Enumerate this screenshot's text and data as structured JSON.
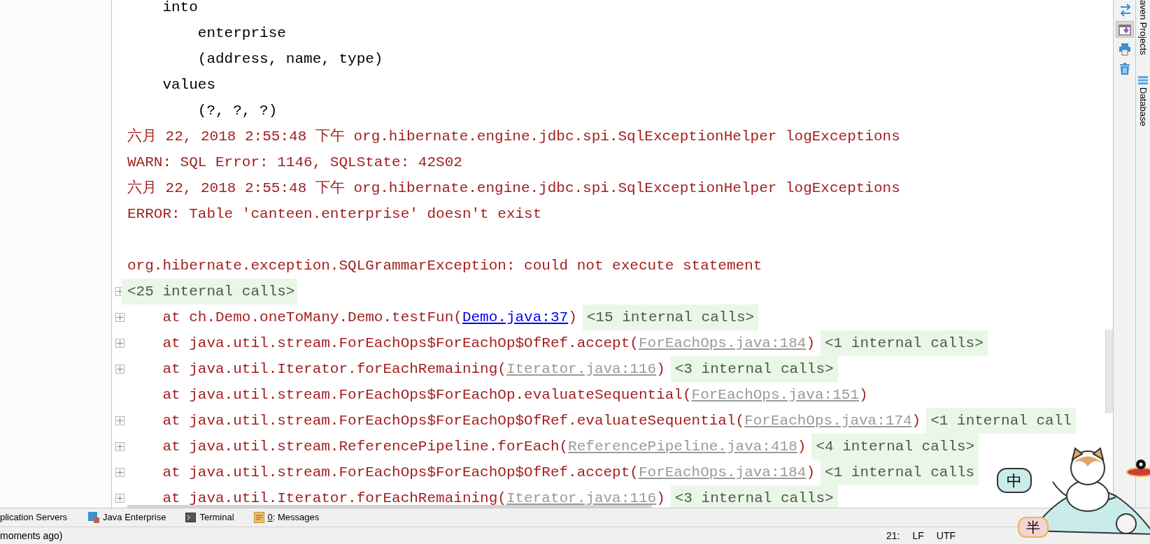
{
  "console": {
    "lines": [
      {
        "kind": "plain",
        "error": false,
        "text": "    into"
      },
      {
        "kind": "plain",
        "error": false,
        "text": "        enterprise"
      },
      {
        "kind": "plain",
        "error": false,
        "text": "        (address, name, type)"
      },
      {
        "kind": "plain",
        "error": false,
        "text": "    values"
      },
      {
        "kind": "plain",
        "error": false,
        "text": "        (?, ?, ?)"
      },
      {
        "kind": "plain",
        "error": true,
        "text": "六月 22, 2018 2:55:48 下午 org.hibernate.engine.jdbc.spi.SqlExceptionHelper logExceptions"
      },
      {
        "kind": "plain",
        "error": true,
        "text": "WARN: SQL Error: 1146, SQLState: 42S02"
      },
      {
        "kind": "plain",
        "error": true,
        "text": "六月 22, 2018 2:55:48 下午 org.hibernate.engine.jdbc.spi.SqlExceptionHelper logExceptions"
      },
      {
        "kind": "plain",
        "error": true,
        "text": "ERROR: Table 'canteen.enterprise' doesn't exist"
      },
      {
        "kind": "blank"
      },
      {
        "kind": "plain",
        "error": true,
        "text": "org.hibernate.exception.SQLGrammarException: could not execute statement"
      },
      {
        "kind": "internal",
        "foldable": true,
        "text": "<25 internal calls>"
      },
      {
        "kind": "frame",
        "foldable": true,
        "text": "    at ch.Demo.oneToMany.Demo.testFun(",
        "link": "Demo.java:37",
        "in_project": true,
        "tail": ")",
        "internal": "<15 internal calls>"
      },
      {
        "kind": "frame",
        "foldable": true,
        "text": "    at java.util.stream.ForEachOps$ForEachOp$OfRef.accept(",
        "link": "ForEachOps.java:184",
        "in_project": false,
        "tail": ")",
        "internal": "<1 internal calls>"
      },
      {
        "kind": "frame",
        "foldable": true,
        "text": "    at java.util.Iterator.forEachRemaining(",
        "link": "Iterator.java:116",
        "in_project": false,
        "tail": ")",
        "internal": "<3 internal calls>"
      },
      {
        "kind": "frame",
        "foldable": false,
        "text": "    at java.util.stream.ForEachOps$ForEachOp.evaluateSequential(",
        "link": "ForEachOps.java:151",
        "in_project": false,
        "tail": ")"
      },
      {
        "kind": "frame",
        "foldable": true,
        "text": "    at java.util.stream.ForEachOps$ForEachOp$OfRef.evaluateSequential(",
        "link": "ForEachOps.java:174",
        "in_project": false,
        "tail": ")",
        "internal": "<1 internal call"
      },
      {
        "kind": "frame",
        "foldable": true,
        "text": "    at java.util.stream.ReferencePipeline.forEach(",
        "link": "ReferencePipeline.java:418",
        "in_project": false,
        "tail": ")",
        "internal": "<4 internal calls>"
      },
      {
        "kind": "frame",
        "foldable": true,
        "text": "    at java.util.stream.ForEachOps$ForEachOp$OfRef.accept(",
        "link": "ForEachOps.java:184",
        "in_project": false,
        "tail": ")",
        "internal": "<1 internal calls"
      },
      {
        "kind": "frame",
        "foldable": true,
        "text": "    at java.util.Iterator.forEachRemaining(",
        "link": "Iterator.java:116",
        "in_project": false,
        "tail": ")",
        "internal": "<3 internal calls>"
      }
    ]
  },
  "right_toolbar": [
    {
      "kind": "swap",
      "selected": false
    },
    {
      "kind": "scroll-to-end",
      "selected": true
    },
    {
      "kind": "print",
      "selected": false
    },
    {
      "kind": "trash",
      "selected": false
    }
  ],
  "side_tabs": [
    {
      "kind": "maven",
      "label": "aven Projects"
    },
    {
      "kind": "database",
      "label": "Database"
    }
  ],
  "tool_tabs": [
    {
      "kind": "servers",
      "label": "plication Servers"
    },
    {
      "kind": "java-ee",
      "label": "Java Enterprise"
    },
    {
      "kind": "terminal",
      "label": "Terminal"
    },
    {
      "kind": "messages",
      "label": "0: Messages",
      "mnemonic": true
    }
  ],
  "status_bar": {
    "message": "moments ago)",
    "items": [
      "21:",
      "LF",
      "UTF"
    ]
  },
  "ime": {
    "mode": "中",
    "width": "半"
  }
}
